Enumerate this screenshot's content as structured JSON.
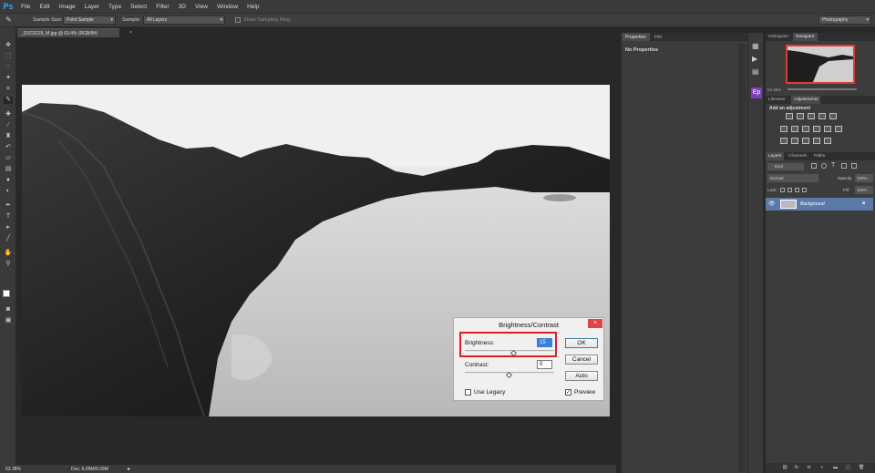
{
  "app": {
    "logo": "Ps"
  },
  "menubar": {
    "items": [
      "File",
      "Edit",
      "Image",
      "Layer",
      "Type",
      "Select",
      "Filter",
      "3D",
      "View",
      "Window",
      "Help"
    ]
  },
  "options": {
    "sample_size_label": "Sample Size:",
    "sample_size_value": "Point Sample",
    "sample_label": "Sample:",
    "sample_value": "All Layers",
    "show_ring_label": "Show Sampling Ring",
    "workspace": "Photography"
  },
  "document": {
    "tab_label": "_DSC6129_M.jpg @ 63.4% (RGB/8#)",
    "close": "×"
  },
  "status": {
    "zoom": "63.38%",
    "doc_info": "Doc: 6.09M/6.09M"
  },
  "properties_panel": {
    "tabs": [
      "Properties",
      "Info"
    ],
    "content": "No Properties"
  },
  "navigator_panel": {
    "tabs": [
      "Histogram",
      "Navigator"
    ],
    "zoom": "63.38%"
  },
  "adjustments_panel": {
    "tabs": [
      "Libraries",
      "Adjustments"
    ],
    "heading": "Add an adjustment"
  },
  "layers_panel": {
    "tabs": [
      "Layers",
      "Channels",
      "Paths"
    ],
    "filter_kind": "Kind",
    "blend_mode": "Normal",
    "opacity_label": "Opacity:",
    "opacity_value": "100%",
    "lock_label": "Lock:",
    "fill_label": "Fill:",
    "fill_value": "100%",
    "layers": [
      {
        "name": "Background"
      }
    ]
  },
  "dialog": {
    "title": "Brightness/Contrast",
    "close": "×",
    "brightness_label": "Brightness:",
    "brightness_value": "15",
    "contrast_label": "Contrast:",
    "contrast_value": "0",
    "ok_label": "OK",
    "cancel_label": "Cancel",
    "auto_label": "Auto",
    "use_legacy_label": "Use Legacy",
    "use_legacy_checked": false,
    "preview_label": "Preview",
    "preview_checked": true,
    "preview_check_glyph": "✓"
  },
  "colors": {
    "highlight": "#e01e26",
    "close_button": "#e04343",
    "brand": "#31a8ff"
  }
}
